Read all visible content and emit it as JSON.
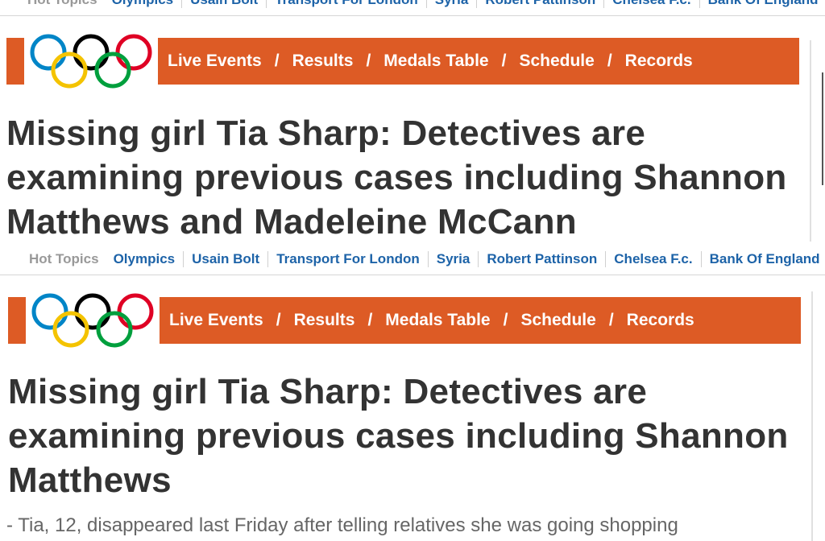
{
  "hot_topics": {
    "label": "Hot Topics",
    "links": [
      "Olympics",
      "Usain Bolt",
      "Transport For London",
      "Syria",
      "Robert Pattinson",
      "Chelsea F.c.",
      "Bank Of England"
    ]
  },
  "olympics_bar": {
    "nav": [
      "Live Events",
      "Results",
      "Medals Table",
      "Schedule",
      "Records"
    ],
    "separator": "/",
    "bar_color": "#dd5b25",
    "ring_colors": [
      "#0085c7",
      "#f4c300",
      "#000000",
      "#009f3d",
      "#df0024"
    ]
  },
  "top_article": {
    "headline_lines": [
      "Missing girl Tia Sharp: Detectives are",
      "examining previous cases including Shannon",
      "Matthews and Madeleine McCann"
    ]
  },
  "bottom_article": {
    "headline_lines": [
      "Missing girl Tia Sharp: Detectives are",
      "examining previous cases including Shannon",
      "Matthews"
    ],
    "standfirst": "- Tia, 12, disappeared last Friday after telling relatives she was going shopping"
  }
}
